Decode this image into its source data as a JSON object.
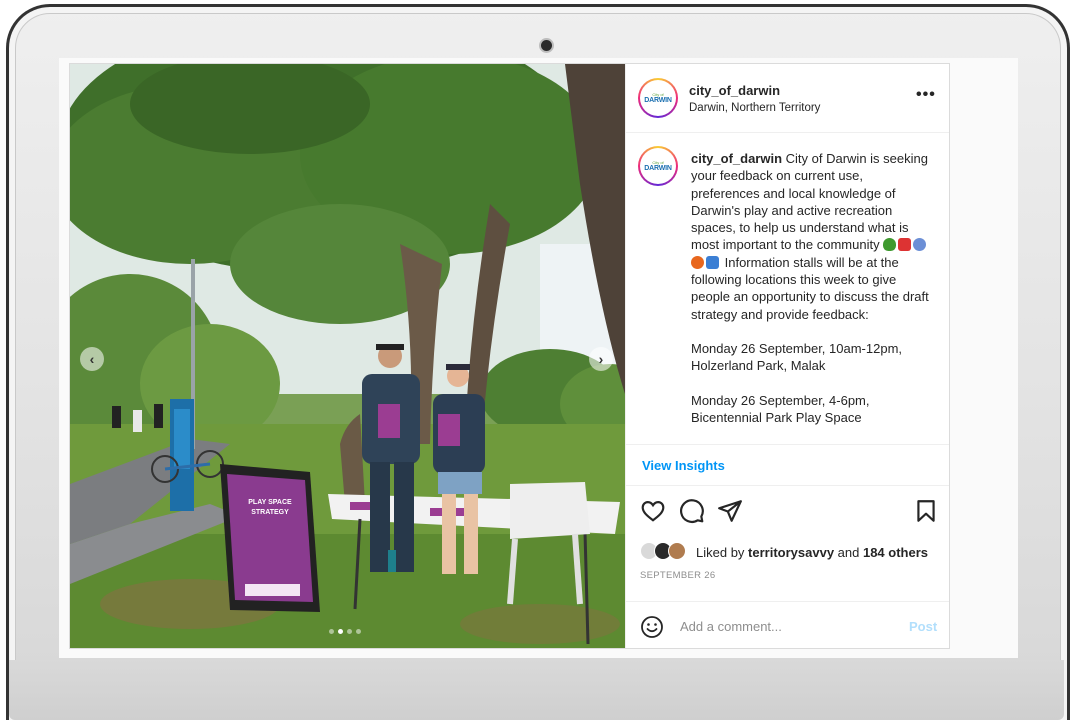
{
  "post": {
    "username": "city_of_darwin",
    "location": "Darwin, Northern Territory",
    "more_label": "•••",
    "avatar_text_top": "City of",
    "avatar_text_main": "DARWIN",
    "caption": {
      "username": "city_of_darwin",
      "text_intro": " City of Darwin is seeking your feedback on current use, preferences and local knowledge of Darwin's play and active recreation spaces, to help us understand what is most important to the community ",
      "text_after_emoji": " Information stalls will be at the following locations this week to give people an opportunity to discuss the draft strategy and provide feedback:",
      "event1": "Monday 26 September, 10am-12pm, Holzerland Park, Malak",
      "event2": "Monday 26 September, 4-6pm, Bicentennial Park Play Space"
    },
    "view_insights": "View Insights",
    "likes": {
      "prefix": "Liked by ",
      "user": "territorysavvy",
      "middle": " and ",
      "others": "184 others"
    },
    "date": "SEPTEMBER 26",
    "comment_placeholder": "Add a comment...",
    "post_label": "Post",
    "photo_sign": {
      "line1": "PLAY SPACE",
      "line2": "STRATEGY"
    }
  },
  "icons": {
    "heart": "heart-icon",
    "comment": "comment-icon",
    "share": "share-icon",
    "save": "bookmark-icon",
    "emoji": "smiley-icon"
  },
  "colors": {
    "link_blue": "#0095f6",
    "post_disabled": "#b2dffc",
    "text": "#262626",
    "muted": "#8e8e8e"
  }
}
